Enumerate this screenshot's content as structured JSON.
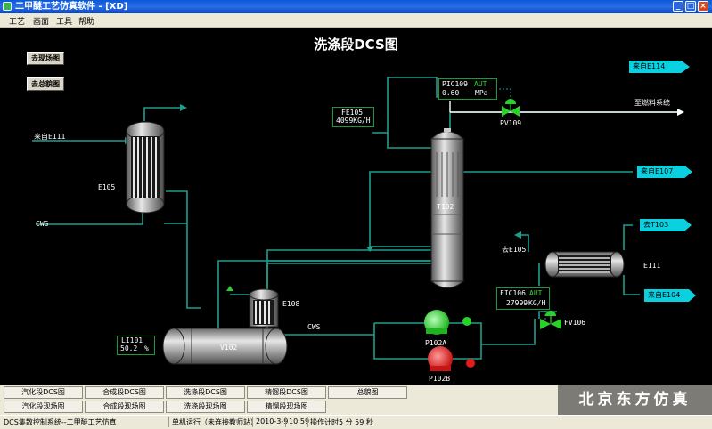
{
  "window": {
    "title": "二甲醚工艺仿真软件 - [XD]",
    "min": "_",
    "max": "□",
    "close": "×"
  },
  "menu": [
    "工艺",
    "画面",
    "工具",
    "帮助"
  ],
  "page_title": "洗涤段DCS图",
  "nav": {
    "field": "去现场图",
    "overview": "去总貌图"
  },
  "tags": {
    "from_e114": "来自E114",
    "to_fuel": "至燃料系统",
    "from_e107": "来自E107",
    "to_t103": "去T103",
    "from_e104": "来自E104",
    "from_e111": "来自E111",
    "to_e105": "去E105",
    "cws1": "CWS",
    "cws2": "CWS"
  },
  "equipment": {
    "e105": "E105",
    "t102": "T102",
    "v102": "V102",
    "e108": "E108",
    "e111": "E111",
    "p102a": "P102A",
    "p102b": "P102B",
    "pv109": "PV109",
    "fv106": "FV106"
  },
  "instruments": {
    "pic109": {
      "tag": "PIC109",
      "mode": "AUT",
      "value": "0.60",
      "unit": "MPa"
    },
    "fe105": {
      "tag": "FE105",
      "value": "4099KG/H"
    },
    "fic106": {
      "tag": "FIC106",
      "mode": "AUT",
      "value": "27999",
      "unit": "KG/H"
    },
    "li101": {
      "tag": "LI101",
      "value": "50.2",
      "unit": "%"
    }
  },
  "pumps": {
    "p102a_status": "running",
    "p102b_status": "stopped"
  },
  "colors": {
    "pipe": "#1e9e8c",
    "running": "#2bd12b",
    "stopped": "#e21b1b",
    "tag_bg": "#0bd0e0"
  },
  "bottom_buttons": {
    "row1": [
      "汽化段DCS图",
      "合成段DCS图",
      "洗涤段DCS图",
      "精馏段DCS图",
      "总貌图"
    ],
    "row2": [
      "汽化段现场图",
      "合成段现场图",
      "洗涤段现场图",
      "精馏段现场图"
    ]
  },
  "brand": "北京东方仿真",
  "status": {
    "system": "DCS集散控制系统--二甲醚工艺仿真",
    "mode": "单机运行（未连接教师站）",
    "date": "2010-3-9",
    "time": "10:59",
    "timer_label": "操作计时：",
    "timer_value": "5 分 59 秒"
  }
}
